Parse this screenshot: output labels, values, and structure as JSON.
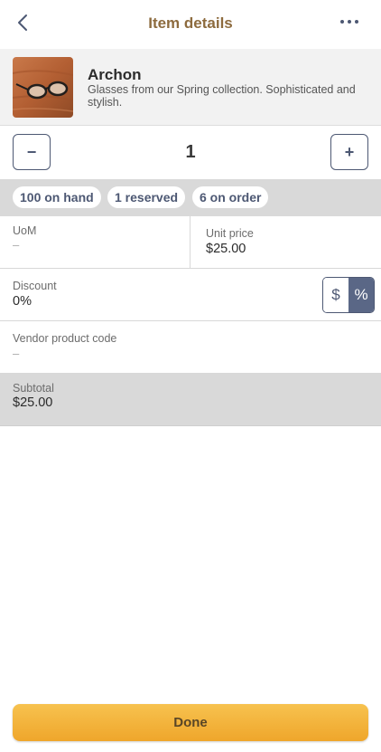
{
  "header": {
    "title": "Item details"
  },
  "product": {
    "name": "Archon",
    "description": "Glasses from our Spring collection. Sophisticated and stylish."
  },
  "quantity": {
    "minus_label": "−",
    "value": "1",
    "plus_label": "+"
  },
  "stock": {
    "on_hand": "100 on hand",
    "reserved": "1 reserved",
    "on_order": "6 on order"
  },
  "fields": {
    "uom": {
      "label": "UoM",
      "value": "–"
    },
    "unit_price": {
      "label": "Unit price",
      "value": "$25.00"
    },
    "discount": {
      "label": "Discount",
      "value": "0%"
    },
    "discount_toggle": {
      "dollar": "$",
      "percent": "%",
      "selected": "percent"
    },
    "vendor_code": {
      "label": "Vendor product code",
      "value": "–"
    },
    "subtotal": {
      "label": "Subtotal",
      "value": "$25.00"
    }
  },
  "footer": {
    "done_label": "Done"
  },
  "colors": {
    "accent": "#4d5873",
    "title": "#8d6b3e",
    "done_button": "#f2b13a"
  }
}
